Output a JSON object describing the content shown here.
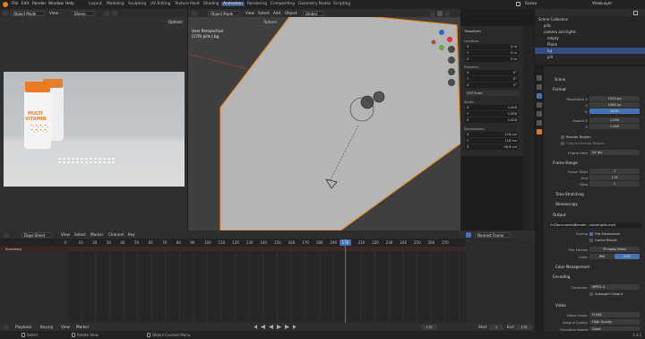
{
  "topbar": {
    "menus": [
      "File",
      "Edit",
      "Render",
      "Window",
      "Help"
    ],
    "workspaces": [
      "Layout",
      "Modeling",
      "Sculpting",
      "UV Editing",
      "Texture Paint",
      "Shading",
      "Animation",
      "Rendering",
      "Compositing",
      "Geometry Nodes",
      "Scripting"
    ],
    "active_workspace": "Animation",
    "scene": "Scene",
    "view_layer": "ViewLayer"
  },
  "left_editor": {
    "mode": "Object Mode",
    "menus": [
      "View"
    ],
    "image_name": "Ebene",
    "options": "Options"
  },
  "viewport": {
    "mode": "Object Mode",
    "menus": [
      "View",
      "Select",
      "Add",
      "Object"
    ],
    "transform_space": "Global",
    "options": "Options",
    "title": "User Perspective",
    "subtitle": "(170) pills | bg"
  },
  "photo": {
    "label_lines": [
      "MULTI",
      "VITAMIN"
    ]
  },
  "npanel": {
    "header": "Transform",
    "location_label": "Location:",
    "location": [
      {
        "axis": "X",
        "value": "0 m"
      },
      {
        "axis": "Y",
        "value": "0 m"
      },
      {
        "axis": "Z",
        "value": "0 m"
      }
    ],
    "rotation_label": "Rotation:",
    "rotation": [
      {
        "axis": "X",
        "value": "0°"
      },
      {
        "axis": "Y",
        "value": "0°"
      },
      {
        "axis": "Z",
        "value": "0°"
      }
    ],
    "rotation_mode": "XYZ Euler",
    "scale_label": "Scale:",
    "scale": [
      {
        "axis": "X",
        "value": "1.000"
      },
      {
        "axis": "Y",
        "value": "1.000"
      },
      {
        "axis": "Z",
        "value": "1.000"
      }
    ],
    "dimensions_label": "Dimensions:",
    "dimensions": [
      {
        "axis": "X",
        "value": "116 cm"
      },
      {
        "axis": "Y",
        "value": "116 cm"
      },
      {
        "axis": "Z",
        "value": "98.6 cm"
      }
    ]
  },
  "outliner": {
    "rows": [
      {
        "label": "Scene Collection",
        "selected": false
      },
      {
        "label": "pills",
        "selected": false
      },
      {
        "label": "camera and lights",
        "selected": false
      },
      {
        "label": "empty",
        "selected": false
      },
      {
        "label": "Plane",
        "selected": false
      },
      {
        "label": "bg",
        "selected": true
      },
      {
        "label": "pill",
        "selected": false
      }
    ]
  },
  "properties": {
    "scene": "Scene",
    "format_header": "Format",
    "resolution_x_label": "Resolution X",
    "resolution_x": "1920 px",
    "resolution_y_label": "Y",
    "resolution_y": "1080 px",
    "res_pct_label": "%",
    "res_pct": "100%",
    "aspect_x_label": "Aspect X",
    "aspect_x": "1.000",
    "aspect_y_label": "Y",
    "aspect_y": "1.000",
    "render_region": "Render Region",
    "crop_region": "Crop to Render Region",
    "frame_rate_label": "Frame Rate",
    "frame_rate": "24 fps",
    "frame_range_header": "Frame Range",
    "frame_start_label": "Frame Start",
    "frame_start": "1",
    "frame_end_label": "End",
    "frame_end": "170",
    "frame_step_label": "Step",
    "frame_step": "1",
    "time_stretching": "Time Stretching",
    "stereoscopy": "Stereoscopy",
    "output_header": "Output",
    "output_path": "D:\\Documents\\Blender ..\\sarah\\pills.mp4",
    "saving_label": "Saving",
    "file_extensions": "File Extensions",
    "cache_result": "Cache Result",
    "file_format_label": "File Format",
    "file_format": "FFmpeg Video",
    "color_label": "Color",
    "color_bw": "BW",
    "color_rgb": "RGB",
    "color_management": "Color Management",
    "encoding_header": "Encoding",
    "container_label": "Container",
    "container": "MPEG-4",
    "autosplit": "Autosplit Output",
    "video_header": "Video",
    "video_codec_label": "Video Codec",
    "video_codec": "H.264",
    "output_quality_label": "Output Quality",
    "output_quality": "High Quality",
    "encoding_speed_label": "Encoding Speed",
    "encoding_speed": "Good"
  },
  "dopesheet": {
    "mode": "Dope Sheet",
    "menus": [
      "View",
      "Select",
      "Marker",
      "Channel",
      "Key"
    ],
    "interp": "Nearest Frame",
    "summary": "Summary",
    "ticks": [
      "0",
      "10",
      "20",
      "30",
      "40",
      "50",
      "60",
      "70",
      "80",
      "90",
      "100",
      "110",
      "120",
      "130",
      "140",
      "150",
      "160",
      "170",
      "180",
      "190",
      "200",
      "210",
      "220",
      "230",
      "240",
      "250",
      "260",
      "270"
    ],
    "current_frame": "170"
  },
  "playbar": {
    "menus": [
      "Playback",
      "Keying",
      "View",
      "Marker"
    ],
    "frame": "170",
    "start_label": "Start",
    "start": "1",
    "end_label": "End",
    "end": "170"
  },
  "statusbar": {
    "items": [
      "Select",
      "Rotate View",
      "Object Context Menu"
    ],
    "version": "3.4.1"
  },
  "colors": {
    "accent": "#3d5b8a",
    "selected_object": "#e8902a",
    "playhead": "#4772b3"
  }
}
